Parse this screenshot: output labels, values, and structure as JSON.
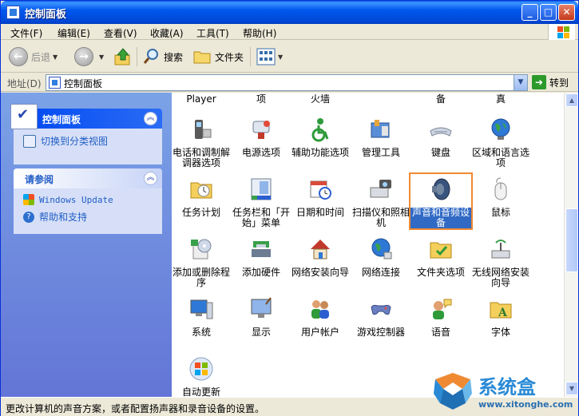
{
  "window": {
    "title": "控制面板"
  },
  "titlebar_buttons": {
    "minimize": "_",
    "maximize": "□",
    "close": "✕"
  },
  "menu": [
    {
      "label": "文件(F)"
    },
    {
      "label": "编辑(E)"
    },
    {
      "label": "查看(V)"
    },
    {
      "label": "收藏(A)"
    },
    {
      "label": "工具(T)"
    },
    {
      "label": "帮助(H)"
    }
  ],
  "toolbar": {
    "back": "后退",
    "search": "搜索",
    "folders": "文件夹"
  },
  "address": {
    "label": "地址(D)",
    "value": "控制面板",
    "go": "转到"
  },
  "sidebar": {
    "control_panel": {
      "title": "控制面板",
      "link": "切换到分类视图"
    },
    "see_also": {
      "title": "请参阅",
      "links": [
        "Windows Update",
        "帮助和支持"
      ]
    }
  },
  "items": {
    "cut_row": [
      "Player",
      "项",
      "火墙",
      "备",
      "真"
    ],
    "row1": [
      "电话和调制解调器选项",
      "电源选项",
      "辅助功能选项",
      "管理工具",
      "键盘",
      "区域和语言选项"
    ],
    "row2": [
      "任务计划",
      "任务栏和「开始」菜单",
      "日期和时间",
      "扫描仪和照相机",
      "声音和音频设备",
      "鼠标"
    ],
    "row3": [
      "添加或删除程序",
      "添加硬件",
      "网络安装向导",
      "网络连接",
      "文件夹选项",
      "无线网络安装向导"
    ],
    "row4": [
      "系统",
      "显示",
      "用户帐户",
      "游戏控制器",
      "语音",
      "字体"
    ],
    "row5": [
      "自动更新"
    ]
  },
  "status": {
    "text": "更改计算机的声音方案，或者配置扬声器和录音设备的设置。"
  },
  "watermark": {
    "title": "系统盒",
    "url": "www.xitonghe.com"
  }
}
